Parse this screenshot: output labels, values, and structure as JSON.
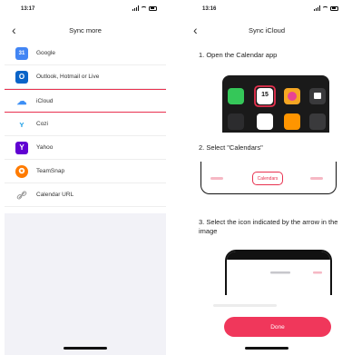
{
  "left": {
    "time": "13:17",
    "title": "Sync more",
    "items": [
      {
        "label": "Google",
        "icon": "google-calendar-icon",
        "color": "#4285f4",
        "glyph": "31"
      },
      {
        "label": "Outlook, Hotmail or Live",
        "icon": "outlook-icon",
        "color": "#0a64c8",
        "glyph": "O"
      },
      {
        "label": "iCloud",
        "icon": "icloud-icon",
        "color": "#ffffff",
        "glyph": "☁"
      },
      {
        "label": "Cozi",
        "icon": "cozi-icon",
        "color": "#ffffff",
        "glyph": "ᵜ"
      },
      {
        "label": "Yahoo",
        "icon": "yahoo-icon",
        "color": "#6001d2",
        "glyph": "Y"
      },
      {
        "label": "TeamSnap",
        "icon": "teamsnap-icon",
        "color": "#ff7b00",
        "glyph": "✪"
      },
      {
        "label": "Calendar URL",
        "icon": "link-icon",
        "color": "#ffffff",
        "glyph": "🔗"
      }
    ]
  },
  "right": {
    "time": "13:16",
    "title": "Sync iCloud",
    "step1": "1. Open the Calendar app",
    "calendar_num": "15",
    "step2": "2. Select \"Calendars\"",
    "calendars_tab": "Calendars",
    "step3": "3. Select the icon indicated by the arrow in the image",
    "done": "Done"
  },
  "colors": {
    "accent": "#f0375b",
    "highlight": "#e8314f"
  }
}
